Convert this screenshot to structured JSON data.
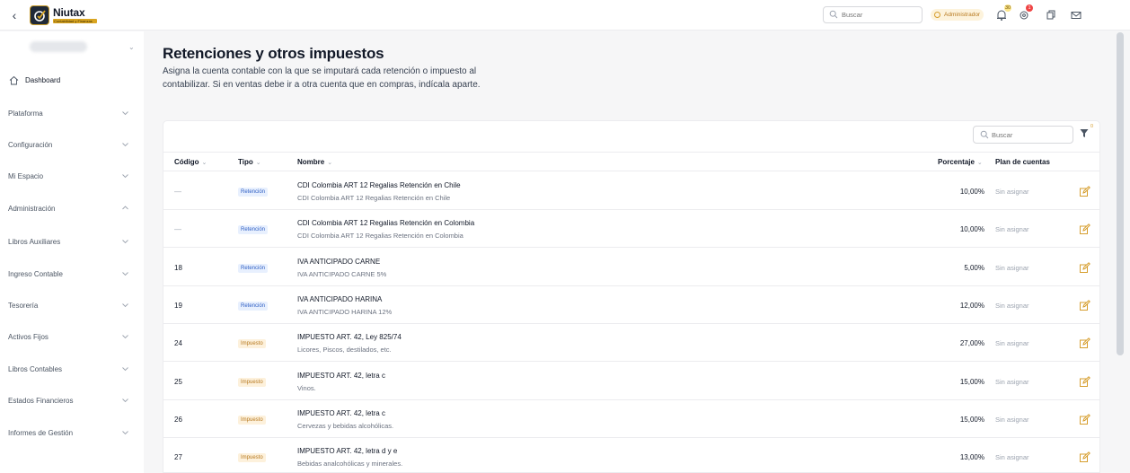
{
  "header": {
    "brand": "Niutax",
    "brand_sub": "Contabilidad y Finanzas",
    "search_placeholder": "Buscar",
    "role": "Administrador",
    "notifications_count": "30",
    "alerts_count": "1"
  },
  "sidebar": {
    "items": [
      {
        "label": "Dashboard",
        "icon": "home-icon",
        "expanded": false
      },
      {
        "label": "Plataforma",
        "expanded": false
      },
      {
        "label": "Configuración",
        "expanded": false
      },
      {
        "label": "Mi Espacio",
        "expanded": false
      },
      {
        "label": "Administración",
        "expanded": true
      },
      {
        "label": "Libros Auxiliares",
        "expanded": false
      },
      {
        "label": "Ingreso Contable",
        "expanded": false
      },
      {
        "label": "Tesorería",
        "expanded": false
      },
      {
        "label": "Activos Fijos",
        "expanded": false
      },
      {
        "label": "Libros Contables",
        "expanded": false
      },
      {
        "label": "Estados Financieros",
        "expanded": false
      },
      {
        "label": "Informes de Gestión",
        "expanded": false
      }
    ]
  },
  "main": {
    "title": "Retenciones y otros impuestos",
    "description": "Asigna la cuenta contable con la que se imputará cada retención o impuesto al contabilizar. Si en ventas debe ir a otra cuenta que en compras, indícala aparte.",
    "search_placeholder": "Buscar",
    "filter_count": "0",
    "columns": {
      "code": "Código",
      "type": "Tipo",
      "name": "Nombre",
      "percent": "Porcentaje",
      "plan": "Plan de cuentas"
    },
    "rows": [
      {
        "code": "—",
        "type": "Retención",
        "kind": "ret",
        "name": "CDI Colombia ART 12 Regalias Retención en Chile",
        "subname": "CDI Colombia ART 12 Regalias Retención en Chile",
        "percent": "10,00%",
        "plan": "Sin asignar"
      },
      {
        "code": "—",
        "type": "Retención",
        "kind": "ret",
        "name": "CDI Colombia ART 12 Regalias Retención en Colombia",
        "subname": "CDI Colombia ART 12 Regalias Retención en Colombia",
        "percent": "10,00%",
        "plan": "Sin asignar"
      },
      {
        "code": "18",
        "type": "Retención",
        "kind": "ret",
        "name": "IVA ANTICIPADO CARNE",
        "subname": "IVA ANTICIPADO CARNE 5%",
        "percent": "5,00%",
        "plan": "Sin asignar"
      },
      {
        "code": "19",
        "type": "Retención",
        "kind": "ret",
        "name": "IVA ANTICIPADO HARINA",
        "subname": "IVA ANTICIPADO HARINA 12%",
        "percent": "12,00%",
        "plan": "Sin asignar"
      },
      {
        "code": "24",
        "type": "Impuesto",
        "kind": "imp",
        "name": "IMPUESTO ART. 42, Ley 825/74",
        "subname": "Licores, Piscos, destilados, etc.",
        "percent": "27,00%",
        "plan": "Sin asignar"
      },
      {
        "code": "25",
        "type": "Impuesto",
        "kind": "imp",
        "name": "IMPUESTO ART. 42, letra c",
        "subname": "Vinos.",
        "percent": "15,00%",
        "plan": "Sin asignar"
      },
      {
        "code": "26",
        "type": "Impuesto",
        "kind": "imp",
        "name": "IMPUESTO ART. 42, letra c",
        "subname": "Cervezas y bebidas alcohólicas.",
        "percent": "15,00%",
        "plan": "Sin asignar"
      },
      {
        "code": "27",
        "type": "Impuesto",
        "kind": "imp",
        "name": "IMPUESTO ART. 42, letra d y e",
        "subname": "Bebidas analcohólicas y minerales.",
        "percent": "13,00%",
        "plan": "Sin asignar"
      }
    ]
  }
}
